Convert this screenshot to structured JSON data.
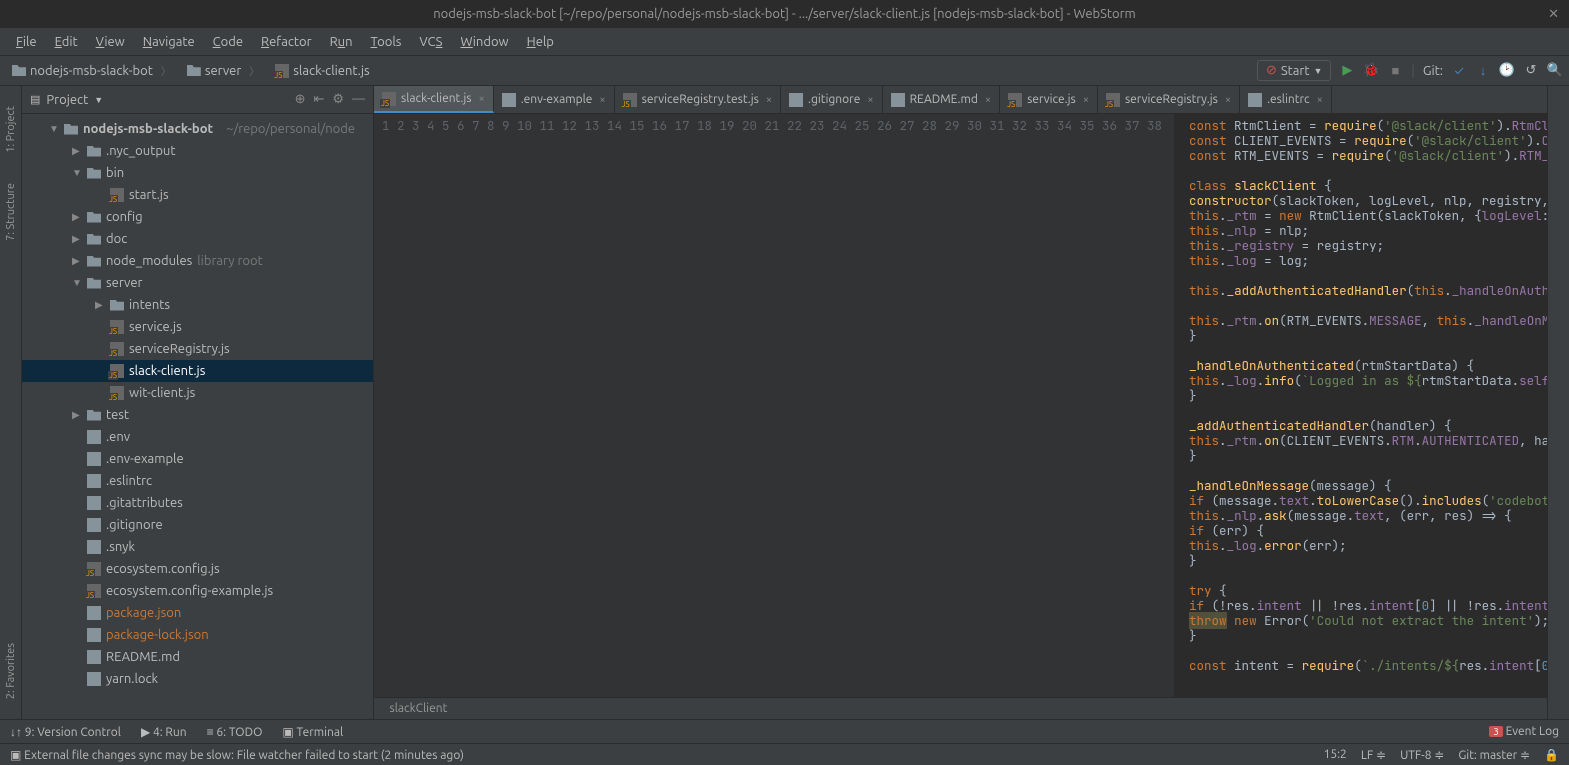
{
  "title": "nodejs-msb-slack-bot [~/repo/personal/nodejs-msb-slack-bot] - .../server/slack-client.js [nodejs-msb-slack-bot] - WebStorm",
  "menu": [
    "File",
    "Edit",
    "View",
    "Navigate",
    "Code",
    "Refactor",
    "Run",
    "Tools",
    "VCS",
    "Window",
    "Help"
  ],
  "breadcrumbs": [
    "nodejs-msb-slack-bot",
    "server",
    "slack-client.js"
  ],
  "run_config": "Start",
  "git_label": "Git:",
  "sidebar": {
    "title": "Project",
    "root": {
      "name": "nodejs-msb-slack-bot",
      "path": "~/repo/personal/node"
    },
    "items": [
      {
        "name": ".nyc_output",
        "type": "folder",
        "depth": 1,
        "arrow": "▶"
      },
      {
        "name": "bin",
        "type": "folder",
        "depth": 1,
        "arrow": "▼"
      },
      {
        "name": "start.js",
        "type": "js",
        "depth": 2
      },
      {
        "name": "config",
        "type": "folder",
        "depth": 1,
        "arrow": "▶"
      },
      {
        "name": "doc",
        "type": "folder",
        "depth": 1,
        "arrow": "▶"
      },
      {
        "name": "node_modules",
        "type": "folder",
        "depth": 1,
        "arrow": "▶",
        "hint": "library root"
      },
      {
        "name": "server",
        "type": "folder",
        "depth": 1,
        "arrow": "▼"
      },
      {
        "name": "intents",
        "type": "folder",
        "depth": 2,
        "arrow": "▶"
      },
      {
        "name": "service.js",
        "type": "js",
        "depth": 2
      },
      {
        "name": "serviceRegistry.js",
        "type": "js",
        "depth": 2
      },
      {
        "name": "slack-client.js",
        "type": "js",
        "depth": 2,
        "selected": true
      },
      {
        "name": "wit-client.js",
        "type": "js",
        "depth": 2
      },
      {
        "name": "test",
        "type": "folder",
        "depth": 1,
        "arrow": "▶"
      },
      {
        "name": ".env",
        "type": "file",
        "depth": 1
      },
      {
        "name": ".env-example",
        "type": "file",
        "depth": 1
      },
      {
        "name": ".eslintrc",
        "type": "file",
        "depth": 1
      },
      {
        "name": ".gitattributes",
        "type": "file",
        "depth": 1
      },
      {
        "name": ".gitignore",
        "type": "file",
        "depth": 1
      },
      {
        "name": ".snyk",
        "type": "file",
        "depth": 1
      },
      {
        "name": "ecosystem.config.js",
        "type": "js",
        "depth": 1
      },
      {
        "name": "ecosystem.config-example.js",
        "type": "js",
        "depth": 1
      },
      {
        "name": "package.json",
        "type": "file",
        "depth": 1,
        "orange": true
      },
      {
        "name": "package-lock.json",
        "type": "file",
        "depth": 1,
        "orange": true
      },
      {
        "name": "README.md",
        "type": "file",
        "depth": 1
      },
      {
        "name": "yarn.lock",
        "type": "file",
        "depth": 1
      }
    ]
  },
  "tabs": [
    {
      "label": "slack-client.js",
      "active": true,
      "icon": "js"
    },
    {
      "label": ".env-example",
      "icon": "file"
    },
    {
      "label": "serviceRegistry.test.js",
      "icon": "js"
    },
    {
      "label": ".gitignore",
      "icon": "file"
    },
    {
      "label": "README.md",
      "icon": "md"
    },
    {
      "label": "service.js",
      "icon": "js"
    },
    {
      "label": "serviceRegistry.js",
      "icon": "js"
    },
    {
      "label": ".eslintrc",
      "icon": "file"
    }
  ],
  "code_lines": [
    1,
    2,
    3,
    4,
    5,
    6,
    7,
    8,
    9,
    10,
    11,
    12,
    13,
    14,
    15,
    16,
    17,
    18,
    19,
    20,
    21,
    22,
    23,
    24,
    25,
    26,
    27,
    28,
    29,
    30,
    31,
    32,
    33,
    34,
    35,
    36,
    37,
    38
  ],
  "breadcrumb_bottom": "slackClient",
  "bottom_tools": {
    "vc": "9: Version Control",
    "run": "4: Run",
    "todo": "6: TODO",
    "term": "Terminal",
    "event": "Event Log",
    "event_count": "3"
  },
  "status": {
    "message": "External file changes sync may be slow: File watcher failed to start (2 minutes ago)",
    "pos": "15:2",
    "le": "LF",
    "enc": "UTF-8",
    "git": "Git: master"
  },
  "rails": {
    "project": "1: Project",
    "structure": "7: Structure",
    "favorites": "2: Favorites"
  }
}
